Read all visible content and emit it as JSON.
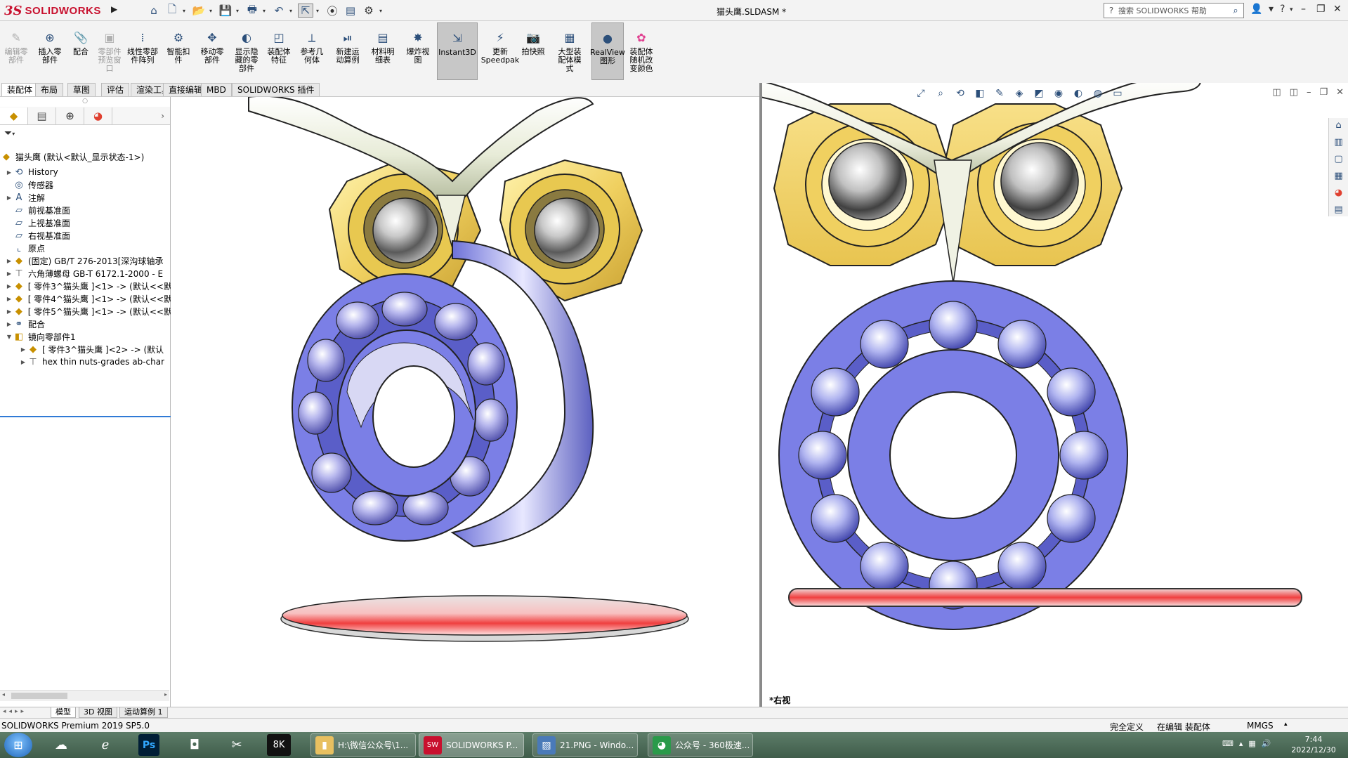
{
  "titlebar": {
    "brand_ds": "3S",
    "brand_name": "SOLIDWORKS",
    "document_title": "猫头鹰.SLDASM *",
    "search_placeholder": "搜索 SOLIDWORKS 帮助",
    "quick_access_icons": [
      "home-icon",
      "new-file-icon",
      "open-icon",
      "save-icon",
      "print-icon",
      "undo-icon",
      "select-icon",
      "traffic-light-icon",
      "file-properties-icon",
      "options-gear-icon"
    ]
  },
  "commands": [
    {
      "label": "编辑零\n部件",
      "icon": "edit-component-icon",
      "disabled": true
    },
    {
      "label": "插入零\n部件",
      "icon": "insert-component-icon",
      "disabled": false
    },
    {
      "label": "配合",
      "icon": "mate-icon",
      "disabled": false
    },
    {
      "label": "零部件\n预览窗\n口",
      "icon": "component-preview-icon",
      "disabled": true
    },
    {
      "label": "线性零部\n件阵列",
      "icon": "linear-pattern-icon",
      "disabled": false
    },
    {
      "label": "智能扣\n件",
      "icon": "smart-fasteners-icon",
      "disabled": false
    },
    {
      "label": "移动零\n部件",
      "icon": "move-component-icon",
      "disabled": false
    },
    {
      "label": "显示隐\n藏的零\n部件",
      "icon": "show-hidden-icon",
      "disabled": false
    },
    {
      "label": "装配体\n特征",
      "icon": "assembly-features-icon",
      "disabled": false
    },
    {
      "label": "参考几\n何体",
      "icon": "reference-geometry-icon",
      "disabled": false
    },
    {
      "label": "新建运\n动算例",
      "icon": "new-motion-study-icon",
      "disabled": false
    },
    {
      "label": "材料明\n细表",
      "icon": "bom-icon",
      "disabled": false
    },
    {
      "label": "爆炸视\n图",
      "icon": "exploded-view-icon",
      "disabled": false
    },
    {
      "label": "Instant3D",
      "icon": "instant3d-icon",
      "disabled": false,
      "active": true
    },
    {
      "label": "更新\nSpeedpak",
      "icon": "speedpak-icon",
      "disabled": false
    },
    {
      "label": "拍快照",
      "icon": "snapshot-icon",
      "disabled": false
    },
    {
      "label": "大型装\n配体模\n式",
      "icon": "large-assembly-icon",
      "disabled": false
    },
    {
      "label": "RealView\n图形",
      "icon": "realview-icon",
      "disabled": false,
      "active": true
    },
    {
      "label": "装配体\n随机改\n变颜色",
      "icon": "random-color-icon",
      "disabled": false
    }
  ],
  "tabs": [
    "装配体",
    "布局",
    "草图",
    "评估",
    "渲染工具",
    "直接编辑",
    "MBD",
    "SOLIDWORKS 插件"
  ],
  "tree": {
    "root": "猫头鹰 (默认<默认_显示状态-1>)",
    "nodes": [
      {
        "label": "History",
        "icon": "history-icon",
        "expand": "▶"
      },
      {
        "label": "传感器",
        "icon": "sensor-icon",
        "expand": ""
      },
      {
        "label": "注解",
        "icon": "annotation-icon",
        "expand": "▶"
      },
      {
        "label": "前视基准面",
        "icon": "plane-icon",
        "expand": ""
      },
      {
        "label": "上视基准面",
        "icon": "plane-icon",
        "expand": ""
      },
      {
        "label": "右视基准面",
        "icon": "plane-icon",
        "expand": ""
      },
      {
        "label": "原点",
        "icon": "origin-icon",
        "expand": ""
      },
      {
        "label": "(固定) GB/T 276-2013[深沟球轴承",
        "icon": "part-icon",
        "expand": "▶"
      },
      {
        "label": "六角薄螺母 GB-T 6172.1-2000 - E",
        "icon": "bolt-icon",
        "expand": "▶"
      },
      {
        "label": "[ 零件3^猫头鹰 ]<1> -> (默认<<默",
        "icon": "part-icon",
        "expand": "▶"
      },
      {
        "label": "[ 零件4^猫头鹰 ]<1> -> (默认<<默",
        "icon": "part-icon",
        "expand": "▶"
      },
      {
        "label": "[ 零件5^猫头鹰 ]<1> -> (默认<<默",
        "icon": "part-icon",
        "expand": "▶"
      },
      {
        "label": "配合",
        "icon": "mates-folder-icon",
        "expand": "▶"
      },
      {
        "label": "镜向零部件1",
        "icon": "mirror-component-icon",
        "expand": "▼"
      },
      {
        "label": "[ 零件3^猫头鹰 ]<2> -> (默认",
        "icon": "part-icon",
        "expand": "▶",
        "indent": 1
      },
      {
        "label": "hex thin nuts-grades ab-char",
        "icon": "bolt-icon",
        "expand": "▶",
        "indent": 1
      }
    ]
  },
  "viewport": {
    "right_view_label": "*右视"
  },
  "bottom_tabs": [
    "模型",
    "3D 视图",
    "运动算例 1"
  ],
  "status": {
    "product": "SOLIDWORKS Premium 2019 SP5.0",
    "defined": "完全定义",
    "editing": "在编辑 装配体",
    "units": "MMGS"
  },
  "taskbar": {
    "windows": [
      {
        "label": "H:\\微信公众号\\1...",
        "icon": "folder-icon"
      },
      {
        "label": "SOLIDWORKS P...",
        "icon": "solidworks-icon",
        "active": true
      },
      {
        "label": "21.PNG - Windo...",
        "icon": "image-viewer-icon"
      },
      {
        "label": "公众号 - 360极速...",
        "icon": "browser-icon"
      }
    ],
    "time": "7:44",
    "date": "2022/12/30"
  },
  "colors": {
    "bearing": "#7b7fe6",
    "nut": "#f0d060",
    "brand": "#c8102e"
  }
}
